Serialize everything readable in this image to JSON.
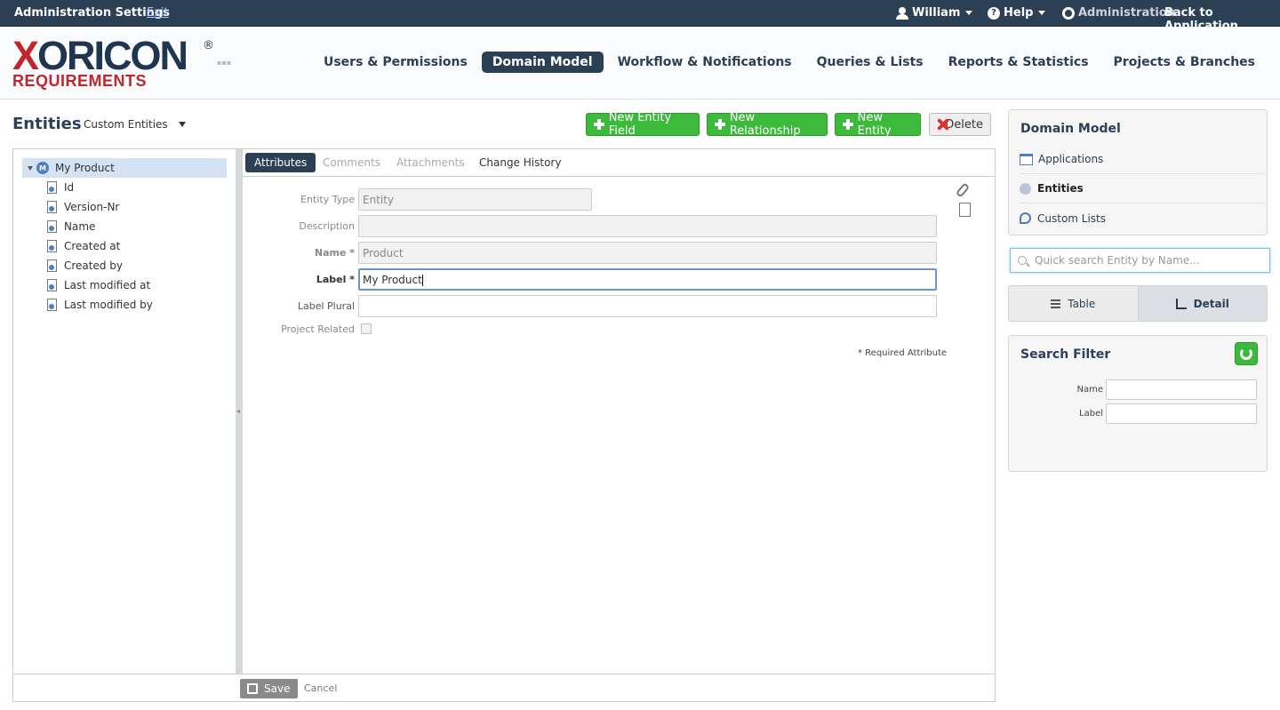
{
  "topbar": {
    "title": "Administration Settings",
    "exit": "Exit",
    "user": "William",
    "help": "Help",
    "admin": "Administration",
    "back": "Back to Application"
  },
  "logo": {
    "brand_x": "X",
    "brand_rest": "ORICON",
    "reg": "®",
    "sub": "REQUIREMENTS"
  },
  "nav": {
    "items": [
      "Users & Permissions",
      "Domain Model",
      "Workflow & Notifications",
      "Queries & Lists",
      "Reports & Statistics",
      "Projects & Branches"
    ],
    "active": "Domain Model"
  },
  "entities": {
    "title": "Entities",
    "filter": "Custom Entities"
  },
  "toolbar": {
    "new_field": "New Entity Field",
    "new_relationship": "New Relationship",
    "new_entity": "New Entity",
    "delete": "Delete"
  },
  "tree": {
    "root": "My Product",
    "items": [
      "Id",
      "Version-Nr",
      "Name",
      "Created at",
      "Created by",
      "Last modified at",
      "Last modified by"
    ]
  },
  "tabs": {
    "attributes": "Attributes",
    "comments": "Comments",
    "attachments": "Attachments",
    "history": "Change History"
  },
  "form": {
    "entity_type_label": "Entity Type",
    "entity_type_value": "Entity",
    "description_label": "Description",
    "description_value": "",
    "name_label": "Name *",
    "name_value": "Product",
    "label_label": "Label *",
    "label_value": "My Product",
    "label_plural_label": "Label Plural",
    "label_plural_value": "",
    "project_related_label": "Project Related",
    "required_note": "* Required Attribute"
  },
  "footer": {
    "save": "Save",
    "cancel": "Cancel"
  },
  "sidebar": {
    "title": "Domain Model",
    "items": [
      "Applications",
      "Entities",
      "Custom Lists"
    ],
    "search_placeholder": "Quick search Entity by Name...",
    "view_table": "Table",
    "view_detail": "Detail",
    "filter_title": "Search Filter",
    "filter_name": "Name",
    "filter_label": "Label"
  },
  "colors": {
    "primary": "#2b3f55",
    "accent_red": "#c0272d",
    "green": "#3cba3c"
  }
}
